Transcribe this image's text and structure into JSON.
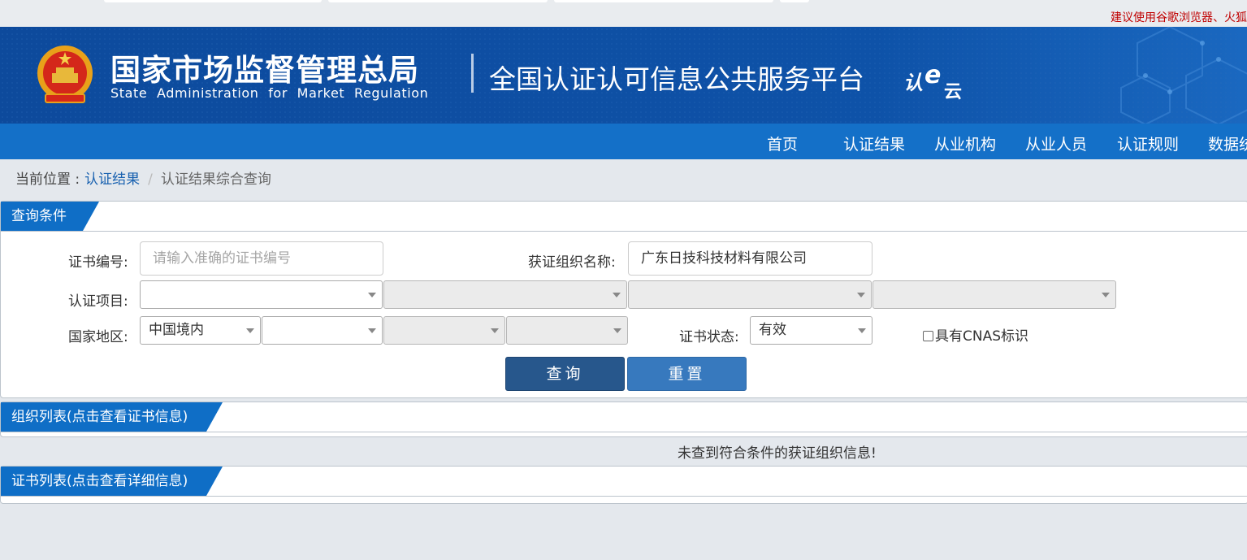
{
  "browser": {
    "notice": "建议使用谷歌浏览器、火狐"
  },
  "header": {
    "agency_cn": "国家市场监督管理总局",
    "agency_en": "State Administration for Market Regulation",
    "platform_title": "全国认证认可信息公共服务平台",
    "cloud_logo_text": "认e云",
    "emblem_icon": "national-emblem-icon"
  },
  "nav": {
    "items": [
      "首页",
      "认证结果",
      "从业机构",
      "从业人员",
      "认证规则",
      "数据统"
    ]
  },
  "breadcrumb": {
    "prefix": "当前位置 :",
    "link": "认证结果",
    "separator": "/",
    "current": "认证结果综合查询"
  },
  "query": {
    "panel_title": "查询条件",
    "cert_no_label": "证书编号:",
    "cert_no_placeholder": "请输入准确的证书编号",
    "org_name_label": "获证组织名称:",
    "org_name_value": "广东日技科技材料有限公司",
    "project_label": "认证项目:",
    "region_label": "国家地区:",
    "region_value": "中国境内",
    "status_label": "证书状态:",
    "status_value": "有效",
    "cnas_label": "具有CNAS标识",
    "query_button": "查询",
    "reset_button": "重置"
  },
  "org_list": {
    "panel_title": "组织列表(点击查看证书信息)",
    "empty_message": "未查到符合条件的获证组织信息!"
  },
  "cert_list": {
    "panel_title": "证书列表(点击查看详细信息)"
  },
  "colors": {
    "banner": "#0e4ea0",
    "nav": "#1470c8",
    "panel_tag": "#0f6ec6",
    "query_button": "#27578c",
    "reset_button": "#3779be",
    "notice": "#c00000"
  }
}
